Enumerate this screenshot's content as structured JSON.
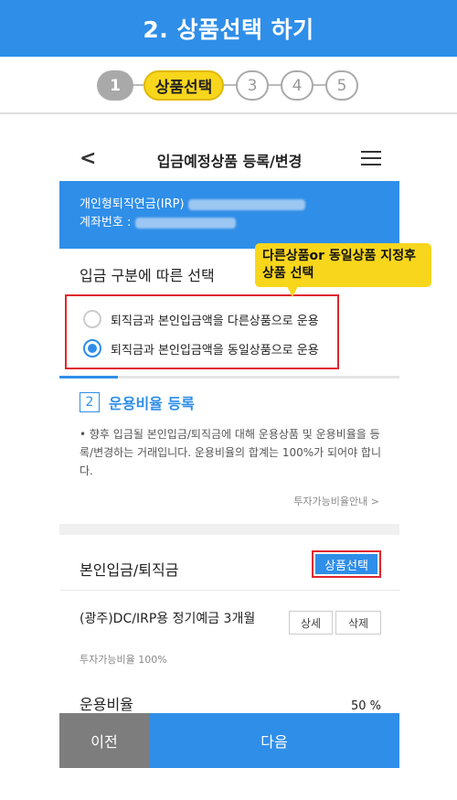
{
  "header": {
    "title": "2. 상품선택 하기"
  },
  "steps": {
    "step1": "1",
    "step2": "상품선택",
    "step3": "3",
    "step4": "4",
    "step5": "5"
  },
  "nav": {
    "back": "<",
    "title": "입금예정상품 등록/변경"
  },
  "account": {
    "plan_label": "개인형퇴직연금(IRP)",
    "account_label": "계좌번호 :"
  },
  "tooltip": {
    "line1": "다른상품or 동일상품 지정후",
    "line2": "상품 선택"
  },
  "section1": {
    "title": "입금 구분에 따른 선택",
    "options": [
      {
        "label": "퇴직금과 본인입금액을 다른상품으로 운용",
        "selected": false
      },
      {
        "label": "퇴직금과 본인입금액을 동일상품으로 운용",
        "selected": true
      }
    ]
  },
  "section2": {
    "num": "2",
    "title": "운용비율 등록",
    "desc": "• 향후 입금될 본인입금/퇴직금에 대해 운용상품 및 운용비율을 등록/변경하는 거래입니다. 운용비율의 합계는 100%가 되어야 합니다.",
    "guide": "투자가능비율안내 >"
  },
  "product_section": {
    "title": "본인입금/퇴직금",
    "select_button": "상품선택",
    "product_name": "(광주)DC/IRP용 정기예금 3개월",
    "product_sub": "투자가능비율 100%",
    "detail_button": "상세",
    "delete_button": "삭제",
    "ratio_label": "운용비율",
    "ratio_value": "50 %"
  },
  "footer": {
    "prev": "이전",
    "next": "다음"
  },
  "colors": {
    "primary": "#2f8ee8",
    "highlight": "#f7d61c",
    "alert": "#e0262d"
  }
}
